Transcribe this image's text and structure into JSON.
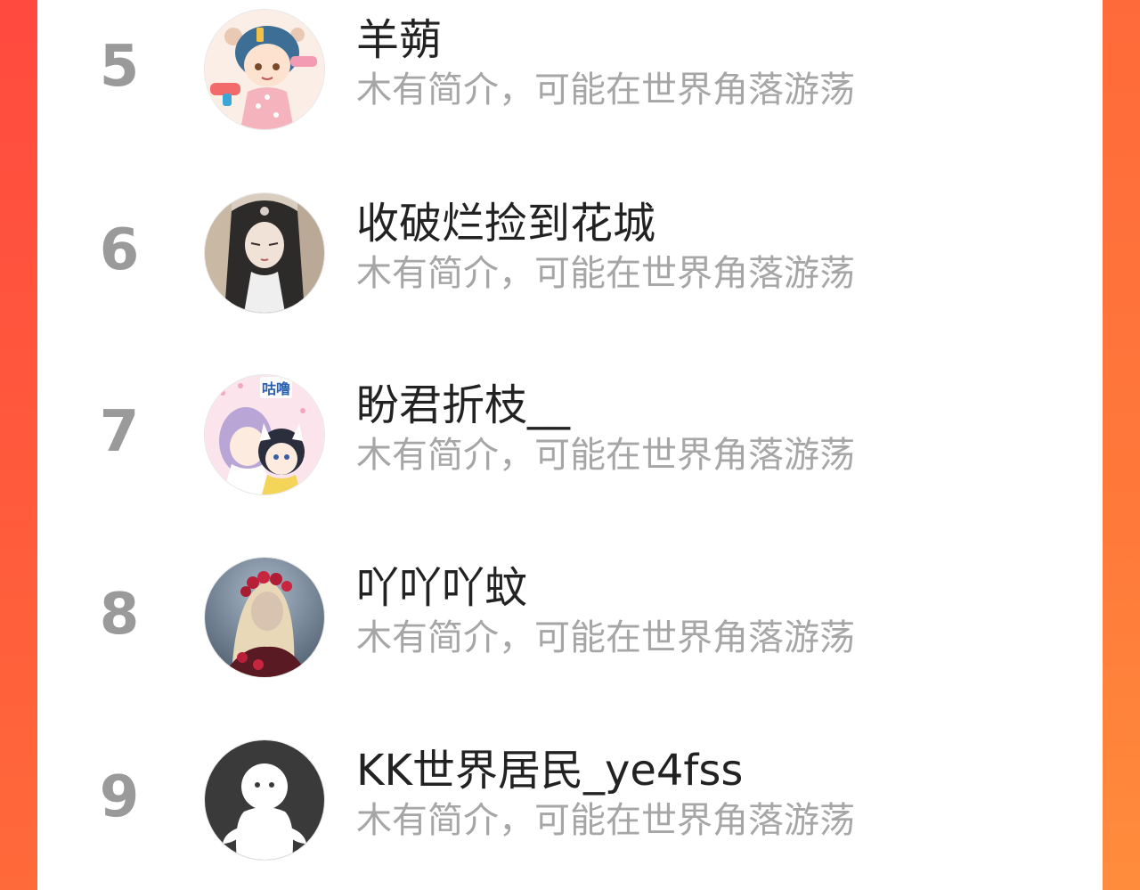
{
  "page": {
    "background_color": "#ff4a3f",
    "card_color": "#ffffff",
    "rank_color": "#9a9a9a",
    "name_color": "#222222",
    "intro_color": "#a6a6a6"
  },
  "ranking": {
    "items": [
      {
        "rank": "5",
        "name": "羊蒴",
        "intro": "木有简介，可能在世界角落游荡",
        "avatar": "anime-girl-water-gun-avatar"
      },
      {
        "rank": "6",
        "name": "收破烂捡到花城",
        "intro": "木有简介，可能在世界角落游荡",
        "avatar": "long-hair-anime-man-avatar"
      },
      {
        "rank": "7",
        "name": "盼君折枝__",
        "intro": "木有简介，可能在世界角落游荡",
        "avatar": "two-anime-girls-avatar",
        "avatar_text": "咕噜"
      },
      {
        "rank": "8",
        "name": "吖吖吖蚊",
        "intro": "木有简介，可能在世界角落游荡",
        "avatar": "girl-with-flower-crown-avatar"
      },
      {
        "rank": "9",
        "name": "KK世界居民_ye4fss",
        "intro": "木有简介，可能在世界角落游荡",
        "avatar": "default-ghost-avatar"
      }
    ]
  }
}
